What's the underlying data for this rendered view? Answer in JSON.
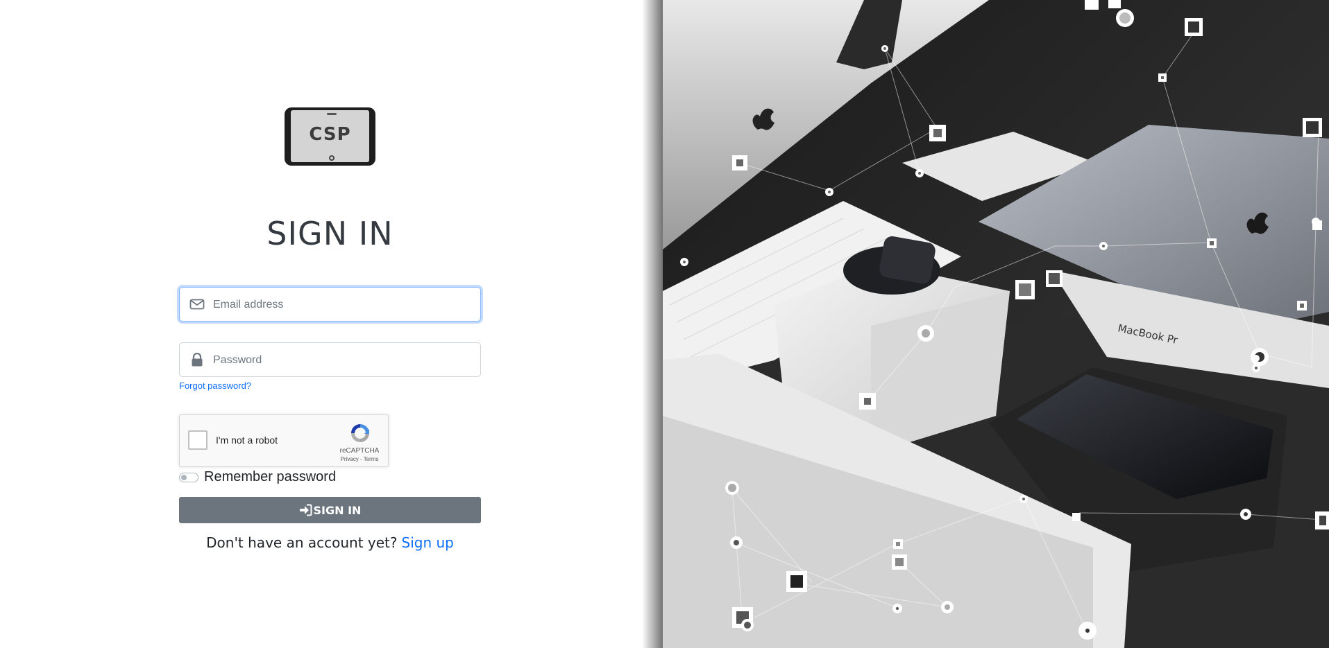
{
  "logo": {
    "text": "CSP"
  },
  "form": {
    "title": "SIGN IN",
    "email_placeholder": "Email address",
    "password_placeholder": "Password",
    "forgot_label": "Forgot password?",
    "recaptcha": {
      "label": "I'm not a robot",
      "brand": "reCAPTCHA",
      "terms": "Privacy - Terms"
    },
    "remember_label": "Remember password",
    "signin_button": "SIGN IN",
    "no_account_text": "Don't have an account yet?",
    "signup_link": "Sign up"
  },
  "colors": {
    "accent": "#0d6efd",
    "button": "#6c757d",
    "title": "#343a40"
  },
  "hero": {
    "description_icons": [
      "apple-logo-icon"
    ],
    "printed_text": "MacBook Pr"
  }
}
